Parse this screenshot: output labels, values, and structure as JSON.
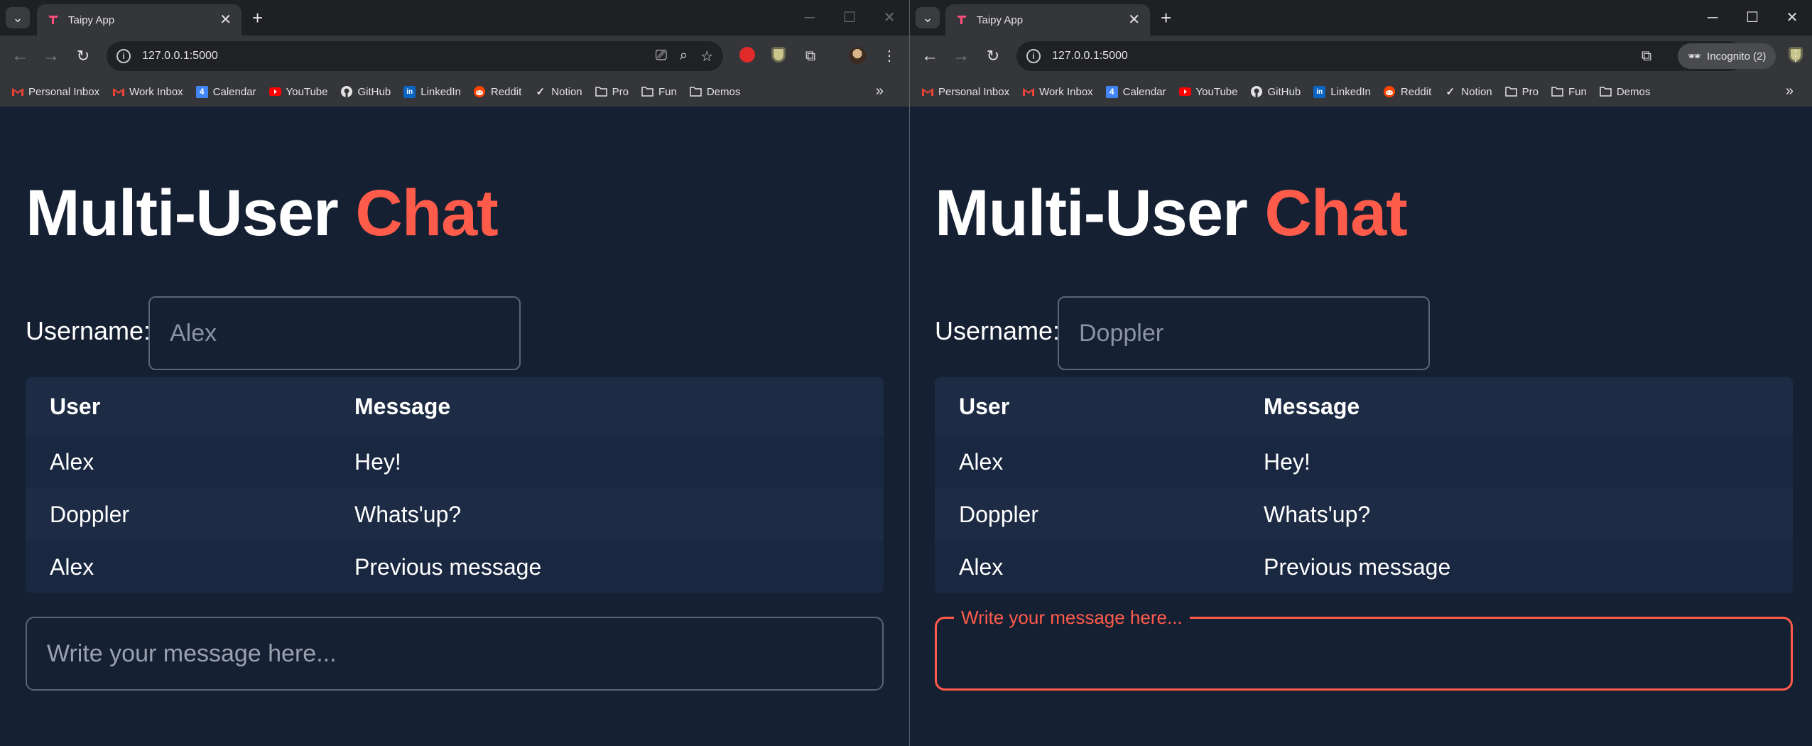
{
  "browser": {
    "tab_title": "Taipy App",
    "url": "127.0.0.1:5000",
    "incognito_label": "Incognito (2)",
    "bookmarks": [
      {
        "label": "Personal Inbox",
        "icon": "gmail-icon"
      },
      {
        "label": "Work Inbox",
        "icon": "gmail-icon"
      },
      {
        "label": "Calendar",
        "icon": "calendar-icon"
      },
      {
        "label": "YouTube",
        "icon": "youtube-icon"
      },
      {
        "label": "GitHub",
        "icon": "github-icon"
      },
      {
        "label": "LinkedIn",
        "icon": "linkedin-icon"
      },
      {
        "label": "Reddit",
        "icon": "reddit-icon"
      },
      {
        "label": "Notion",
        "icon": "check-icon"
      },
      {
        "label": "Pro",
        "icon": "folder-icon"
      },
      {
        "label": "Fun",
        "icon": "folder-icon"
      },
      {
        "label": "Demos",
        "icon": "folder-icon"
      }
    ]
  },
  "app": {
    "title_main": "Multi-User",
    "title_accent": "Chat",
    "username_label": "Username:",
    "table_headers": {
      "user": "User",
      "message": "Message"
    },
    "messages": [
      {
        "user": "Alex",
        "message": "Hey!"
      },
      {
        "user": "Doppler",
        "message": "Whats'up?"
      },
      {
        "user": "Alex",
        "message": "Previous message"
      }
    ],
    "message_placeholder": "Write your message here...",
    "accent_color": "#ff5b4a",
    "background_color": "#162033"
  },
  "windows": {
    "left": {
      "username": "Alex"
    },
    "right": {
      "username": "Doppler"
    }
  }
}
